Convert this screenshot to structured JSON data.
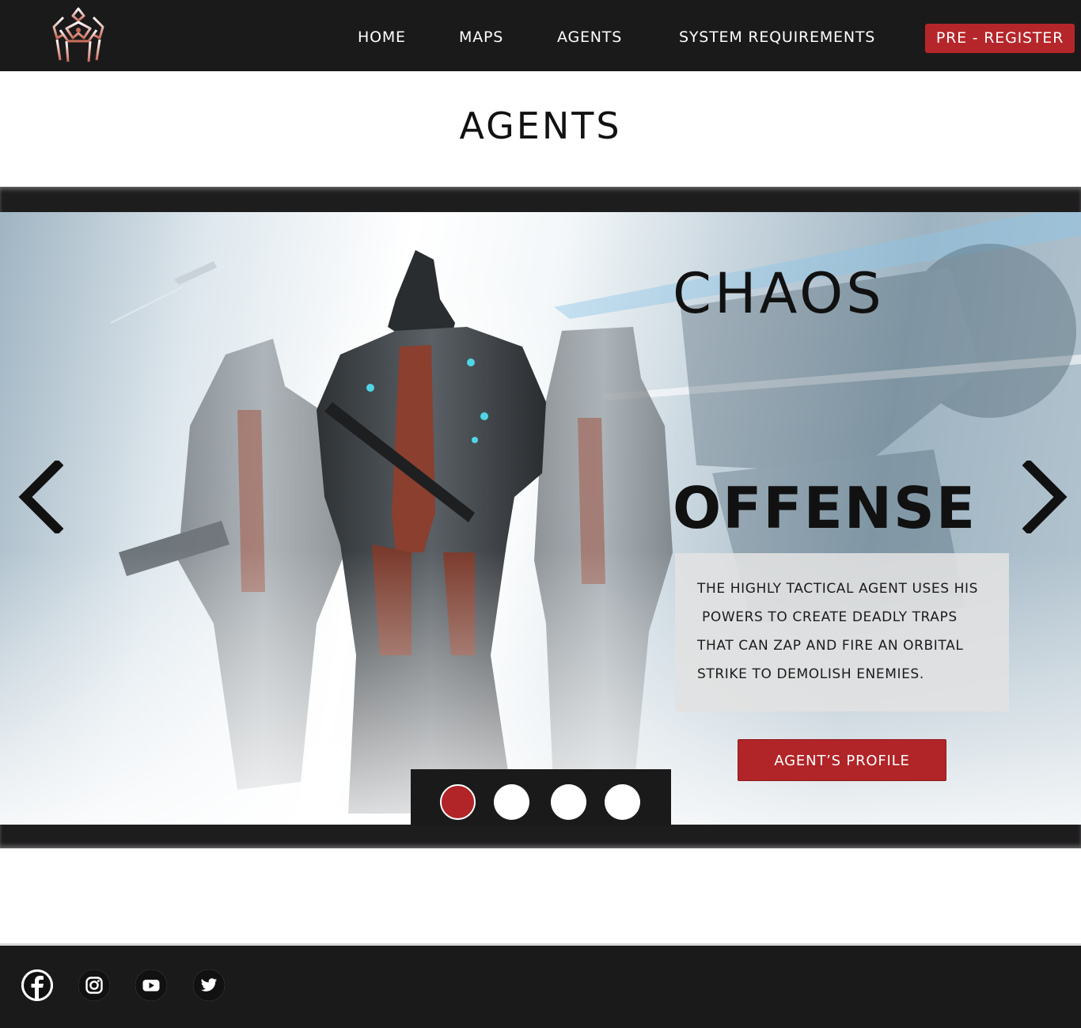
{
  "header": {
    "logo": "lotus-emblem-logo",
    "nav": [
      "HOME",
      "MAPS",
      "AGENTS",
      "SYSTEM REQUIREMENTS"
    ],
    "cta_label": "PRE - REGISTER"
  },
  "page": {
    "title": "AGENTS"
  },
  "slider": {
    "agent_name": "CHAOS",
    "agent_role": "OFFENSE",
    "description_lines": [
      "THE HIGHLY TACTICAL AGENT USES HIS",
      " POWERS TO CREATE DEADLY TRAPS",
      "THAT CAN ZAP AND FIRE AN ORBITAL",
      "STRIKE TO DEMOLISH ENEMIES."
    ],
    "profile_button_label": "AGENT’S PROFILE",
    "prev_icon": "chevron-left-icon",
    "next_icon": "chevron-right-icon",
    "slide_count": 4,
    "active_slide": 1
  },
  "footer": {
    "social_icons": [
      "facebook-icon",
      "instagram-icon",
      "youtube-icon",
      "twitter-icon"
    ]
  },
  "colors": {
    "dark": "#1b1a1b",
    "accent_red": "#b12427",
    "text_dark": "#111111"
  }
}
